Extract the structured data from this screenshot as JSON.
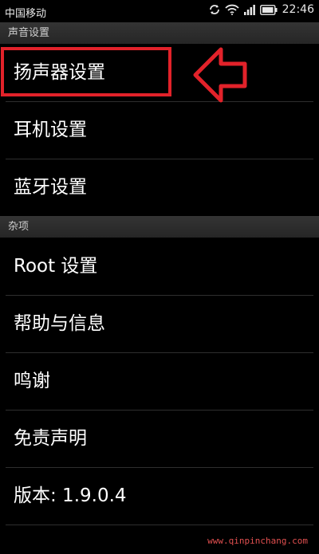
{
  "status": {
    "carrier": "中国移动",
    "time": "22:46",
    "icons": [
      "sync-icon",
      "wifi-icon",
      "signal-icon",
      "battery-icon"
    ]
  },
  "sections": [
    {
      "header": "声音设置",
      "items": [
        "扬声器设置",
        "耳机设置",
        "蓝牙设置"
      ]
    },
    {
      "header": "杂项",
      "items": [
        "Root 设置",
        "帮助与信息",
        "鸣谢",
        "免责声明",
        "版本: 1.9.0.4"
      ]
    }
  ],
  "watermark": "www.qinpinchang.com",
  "colors": {
    "highlight": "#e2222a",
    "background": "#000000",
    "section_header": "#2b2b2b"
  }
}
